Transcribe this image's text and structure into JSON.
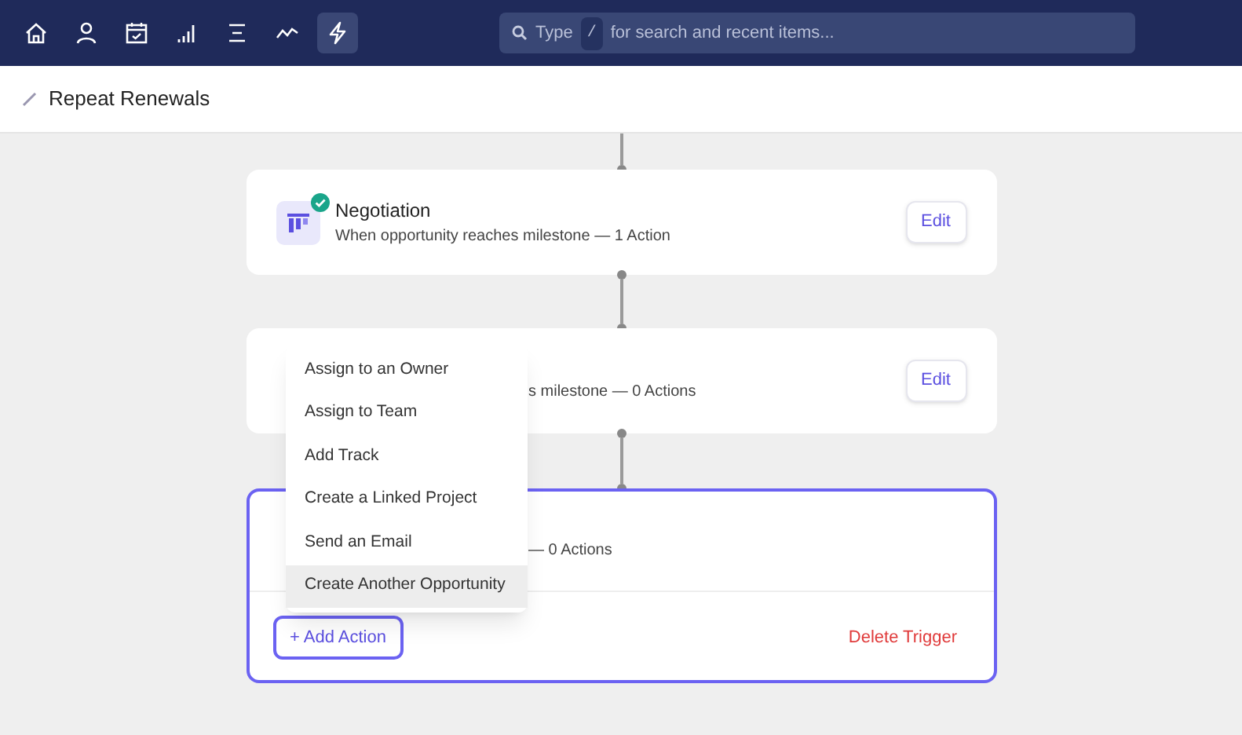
{
  "nav": [
    {
      "kind": "home",
      "selected": false
    },
    {
      "kind": "user",
      "selected": false
    },
    {
      "kind": "calendar",
      "selected": false
    },
    {
      "kind": "signal",
      "selected": false
    },
    {
      "kind": "list",
      "selected": false
    },
    {
      "kind": "trend",
      "selected": false
    },
    {
      "kind": "bolt",
      "selected": true
    }
  ],
  "search": {
    "label": "Type",
    "key": "/",
    "placeholder": "for search and recent items..."
  },
  "page_title": "Repeat Renewals",
  "triggers": [
    {
      "title": "Negotiation",
      "subtitle": "When opportunity reaches milestone — 1 Action",
      "done": true,
      "active": false,
      "edit": "Edit"
    },
    {
      "subtitle": "s milestone — 0 Actions",
      "active": false,
      "edit": "Edit"
    },
    {
      "subtitle": "— 0 Actions",
      "active": true,
      "add_action": "+ Add Action",
      "delete": "Delete Trigger"
    }
  ],
  "menu": [
    {
      "label": "Assign to an Owner",
      "selected": false
    },
    {
      "label": "Assign to Team",
      "selected": false
    },
    {
      "label": "Add Track",
      "selected": false
    },
    {
      "label": "Create a Linked Project",
      "selected": false
    },
    {
      "label": "Send an Email",
      "selected": false
    },
    {
      "label": "Create Another Opportunity",
      "selected": true
    }
  ]
}
